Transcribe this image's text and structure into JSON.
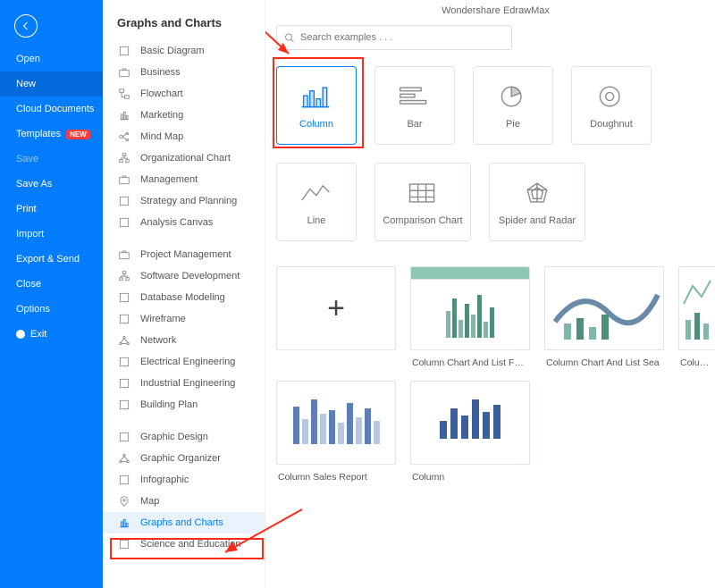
{
  "app_title": "Wondershare EdrawMax",
  "blue_menu": {
    "open": "Open",
    "new": "New",
    "cloud": "Cloud Documents",
    "templates": "Templates",
    "templates_badge": "NEW",
    "save": "Save",
    "save_as": "Save As",
    "print": "Print",
    "import": "Import",
    "export": "Export & Send",
    "close": "Close",
    "options": "Options",
    "exit": "Exit"
  },
  "category_heading": "Graphs and Charts",
  "catgroups": [
    [
      "Basic Diagram",
      "Business",
      "Flowchart",
      "Marketing",
      "Mind Map",
      "Organizational Chart",
      "Management",
      "Strategy and Planning",
      "Analysis Canvas"
    ],
    [
      "Project Management",
      "Software Development",
      "Database Modeling",
      "Wireframe",
      "Network",
      "Electrical Engineering",
      "Industrial Engineering",
      "Building Plan"
    ],
    [
      "Graphic Design",
      "Graphic Organizer",
      "Infographic",
      "Map",
      "Graphs and Charts",
      "Science and Education"
    ]
  ],
  "search_placeholder": "Search examples . . .",
  "cards": {
    "column": "Column",
    "bar": "Bar",
    "pie": "Pie",
    "doughnut": "Doughnut",
    "line": "Line",
    "comparison": "Comparison Chart",
    "spider": "Spider and Radar"
  },
  "templates": {
    "fade": "Column Chart And List Fade",
    "sea": "Column Chart And List Sea",
    "cut": "Column Cha",
    "sales": "Column Sales Report",
    "column": "Column"
  }
}
